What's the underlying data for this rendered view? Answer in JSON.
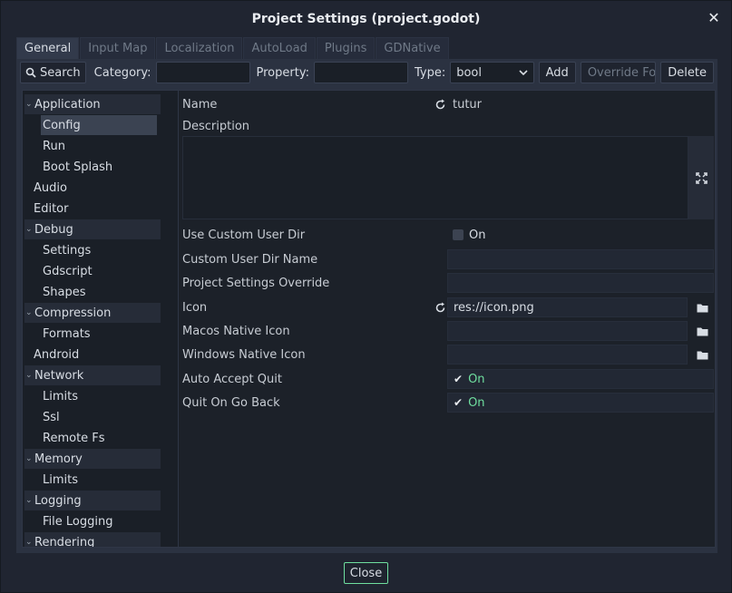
{
  "window": {
    "title": "Project Settings (project.godot)",
    "close_glyph": "✕"
  },
  "tabs": [
    {
      "label": "General",
      "active": true
    },
    {
      "label": "Input Map"
    },
    {
      "label": "Localization"
    },
    {
      "label": "AutoLoad"
    },
    {
      "label": "Plugins"
    },
    {
      "label": "GDNative"
    }
  ],
  "toolbar": {
    "search_label": "Search",
    "category_label": "Category:",
    "category_value": "",
    "property_label": "Property:",
    "property_value": "",
    "type_label": "Type:",
    "type_value": "bool",
    "add_label": "Add",
    "override_label": "Override For...",
    "delete_label": "Delete"
  },
  "tree": [
    {
      "label": "Application",
      "section": true
    },
    {
      "label": "Config",
      "selected": true
    },
    {
      "label": "Run"
    },
    {
      "label": "Boot Splash"
    },
    {
      "label": "Audio",
      "top": true
    },
    {
      "label": "Editor",
      "top": true
    },
    {
      "label": "Debug",
      "section": true
    },
    {
      "label": "Settings"
    },
    {
      "label": "Gdscript"
    },
    {
      "label": "Shapes"
    },
    {
      "label": "Compression",
      "section": true
    },
    {
      "label": "Formats"
    },
    {
      "label": "Android",
      "top": true
    },
    {
      "label": "Network",
      "section": true
    },
    {
      "label": "Limits"
    },
    {
      "label": "Ssl"
    },
    {
      "label": "Remote Fs"
    },
    {
      "label": "Memory",
      "section": true
    },
    {
      "label": "Limits"
    },
    {
      "label": "Logging",
      "section": true
    },
    {
      "label": "File Logging"
    },
    {
      "label": "Rendering",
      "section": true
    }
  ],
  "properties": {
    "name": {
      "label": "Name",
      "value": "tutur"
    },
    "description": {
      "label": "Description",
      "value": ""
    },
    "use_custom_user_dir": {
      "label": "Use Custom User Dir",
      "value": "On",
      "checked": false
    },
    "custom_user_dir_name": {
      "label": "Custom User Dir Name",
      "value": ""
    },
    "project_settings_override": {
      "label": "Project Settings Override",
      "value": ""
    },
    "icon": {
      "label": "Icon",
      "value": "res://icon.png"
    },
    "macos_native_icon": {
      "label": "Macos Native Icon",
      "value": ""
    },
    "windows_native_icon": {
      "label": "Windows Native Icon",
      "value": ""
    },
    "auto_accept_quit": {
      "label": "Auto Accept Quit",
      "value": "On",
      "checked": true
    },
    "quit_on_go_back": {
      "label": "Quit On Go Back",
      "value": "On",
      "checked": true
    }
  },
  "footer": {
    "close_label": "Close"
  },
  "colors": {
    "accent_green": "#6fdf9f",
    "background": "#202531"
  }
}
